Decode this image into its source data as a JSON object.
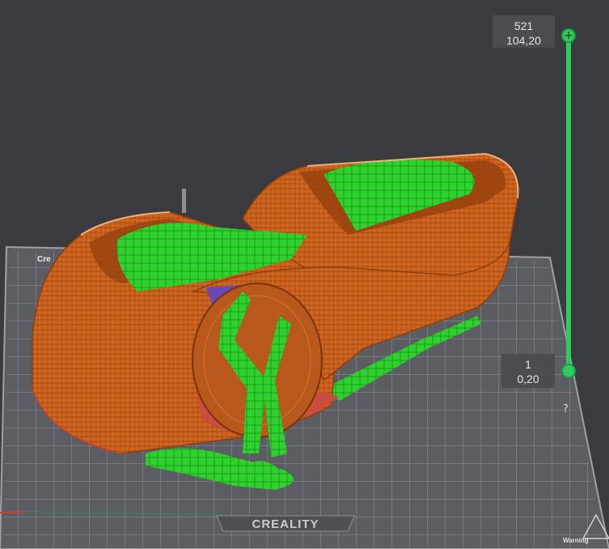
{
  "viewport": {
    "background": "#3a3b3e",
    "bed": {
      "brand_label": "CREALITY",
      "corner_label_left": "Cre",
      "corner_label_right": "Warning",
      "grid_color": "#b8babd",
      "plate_color": "#5b5d62"
    },
    "model": {
      "shell_color": "#c8611e",
      "support_color": "#33e033",
      "bridge_color": "#d9534f"
    }
  },
  "layer_slider": {
    "accent": "#2ecc5f",
    "top": {
      "layer": "521",
      "height": "104,20",
      "icon": "plus-icon"
    },
    "bottom": {
      "layer": "1",
      "height": "0,20"
    },
    "help": "?"
  }
}
